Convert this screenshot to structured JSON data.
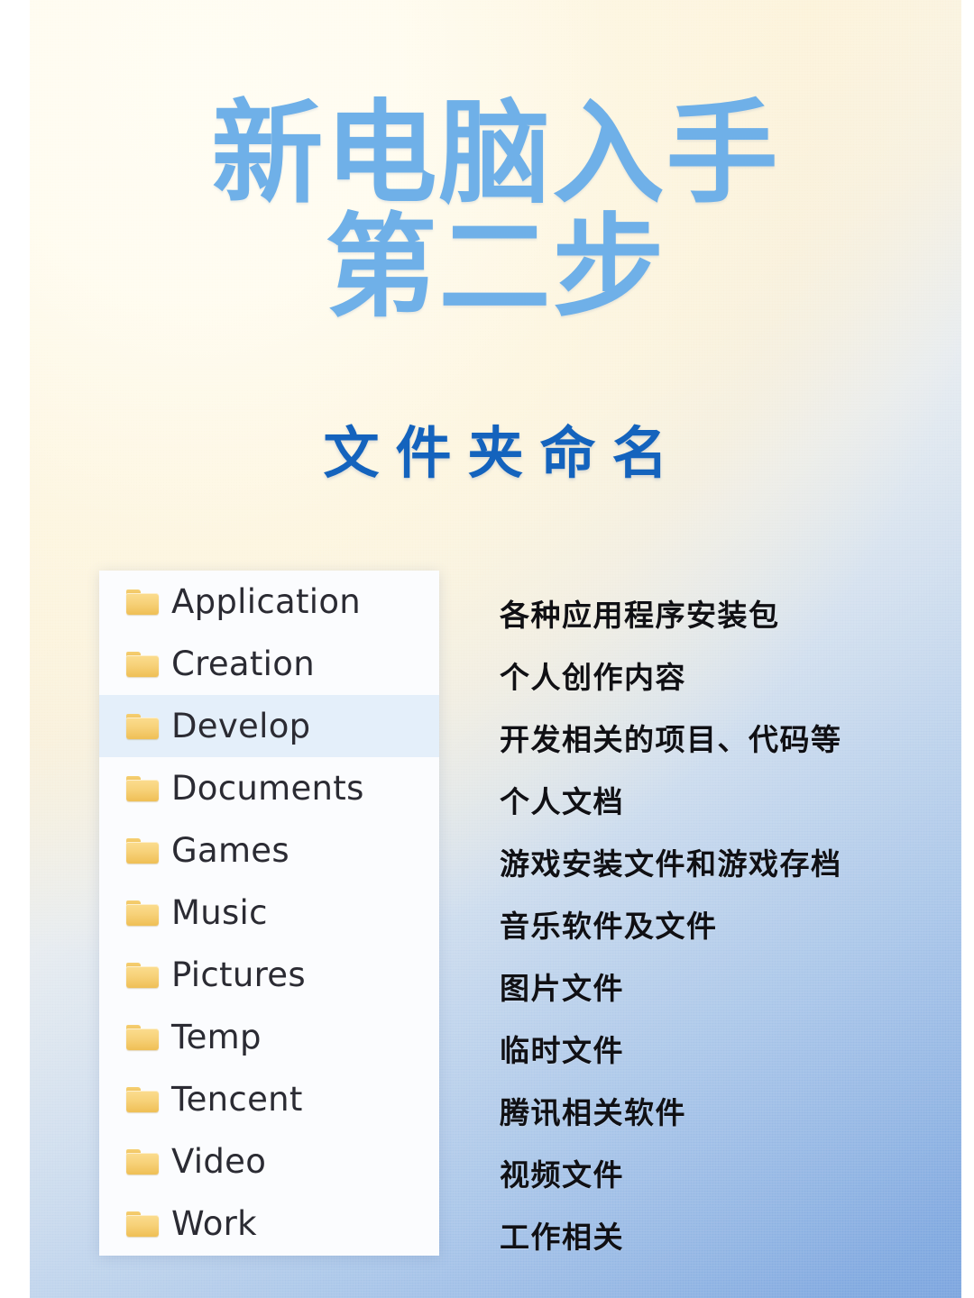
{
  "poster": {
    "headline_line1": "新电脑入手",
    "headline_line2": "第二步",
    "subtitle": "文件夹命名",
    "colors": {
      "headline": "#6fb0e8",
      "subtitle": "#1463bd",
      "background_start": "#fffdf4",
      "background_end": "#7ba4de",
      "panel_background": "#fbfcfe",
      "selected_row": "#e4effa",
      "folder_icon": "#f7d27a",
      "description_text": "#101014"
    }
  },
  "folder_list": {
    "selected_index": 2,
    "items": [
      {
        "name": "Application",
        "icon": "folder-icon",
        "description": "各种应用程序安装包"
      },
      {
        "name": "Creation",
        "icon": "folder-icon",
        "description": "个人创作内容"
      },
      {
        "name": "Develop",
        "icon": "folder-icon",
        "description": "开发相关的项目、代码等"
      },
      {
        "name": "Documents",
        "icon": "folder-icon",
        "description": "个人文档"
      },
      {
        "name": "Games",
        "icon": "folder-icon",
        "description": "游戏安装文件和游戏存档"
      },
      {
        "name": "Music",
        "icon": "folder-icon",
        "description": "音乐软件及文件"
      },
      {
        "name": "Pictures",
        "icon": "folder-icon",
        "description": "图片文件"
      },
      {
        "name": "Temp",
        "icon": "folder-icon",
        "description": "临时文件"
      },
      {
        "name": "Tencent",
        "icon": "folder-icon",
        "description": "腾讯相关软件"
      },
      {
        "name": "Video",
        "icon": "folder-icon",
        "description": "视频文件"
      },
      {
        "name": "Work",
        "icon": "folder-icon",
        "description": "工作相关"
      }
    ]
  }
}
